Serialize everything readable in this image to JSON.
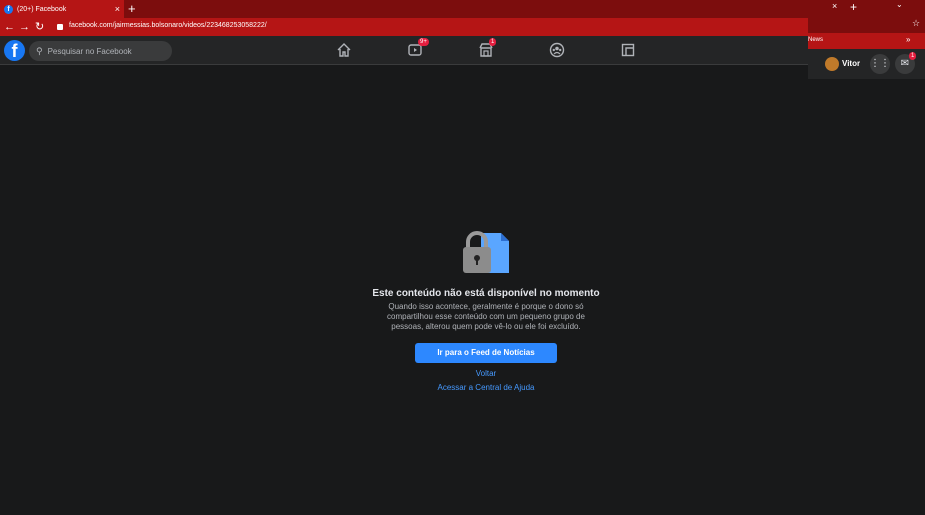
{
  "browser": {
    "tab_title": "(20+) Facebook",
    "tab_close": "×",
    "new_tab": "+",
    "url": "facebook.com/jairmessias.bolsonaro/videos/223468253058222/"
  },
  "fb": {
    "logo": "f",
    "search_placeholder": "Pesquisar no Facebook",
    "watch_badge": "9+",
    "marketplace_badge": "1"
  },
  "error": {
    "title": "Este conteúdo não está disponível no momento",
    "description": "Quando isso acontece, geralmente é porque o dono só compartilhou esse conteúdo com um pequeno grupo de pessoas, alterou quem pode vê-lo ou ele foi excluído.",
    "feed_button": "Ir para o Feed de Notícias",
    "back_link": "Voltar",
    "help_link": "Acessar a Central de Ajuda"
  },
  "right_window": {
    "close": "×",
    "new_tab": "+",
    "bookmark": "News",
    "more": "»",
    "user_name": "Vitor",
    "messenger_badge": "1"
  },
  "colors": {
    "browser_dark": "#7c0d0d",
    "browser_red": "#b51515",
    "fb_blue": "#2d88ff",
    "fb_bg": "#18191a",
    "fb_bar": "#242526"
  },
  "icons": [
    "back-arrow-icon",
    "forward-arrow-icon",
    "reload-icon",
    "lock-icon",
    "search-icon",
    "home-icon",
    "watch-icon",
    "marketplace-icon",
    "groups-icon",
    "gaming-icon",
    "star-icon",
    "menu-grid-icon",
    "messenger-icon",
    "padlock-document-icon"
  ]
}
